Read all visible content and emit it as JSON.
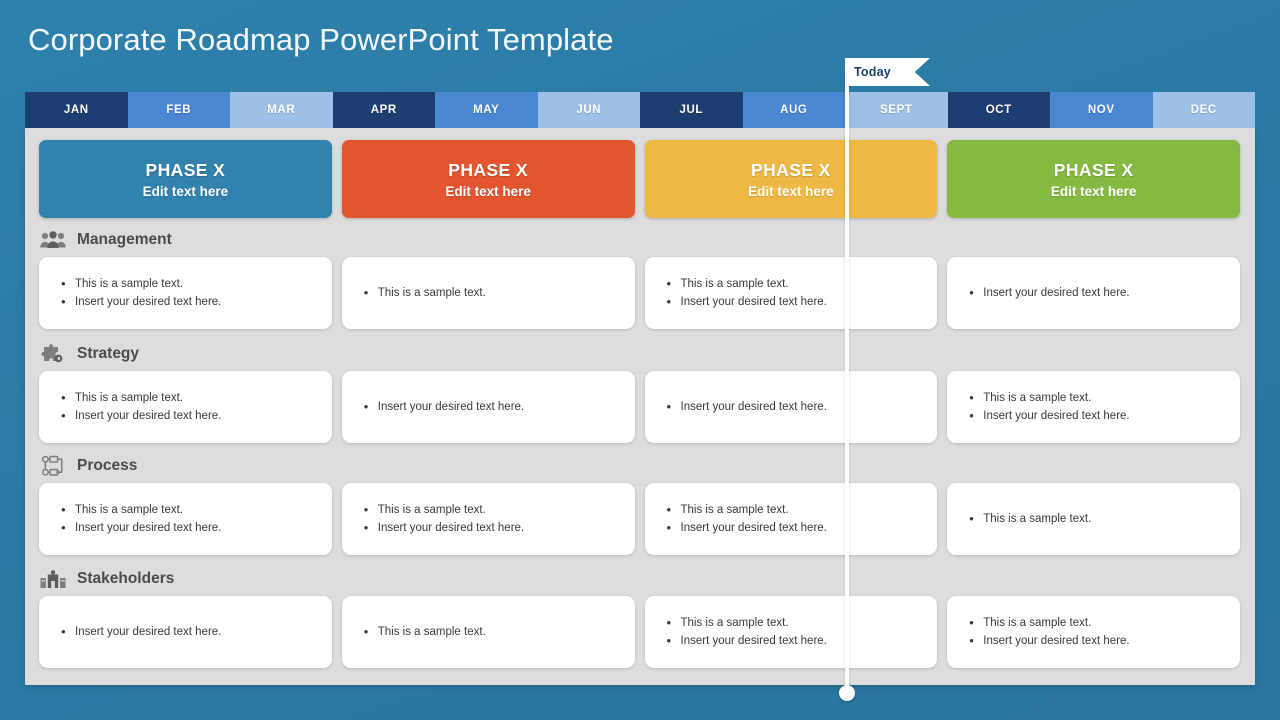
{
  "title": "Corporate Roadmap PowerPoint Template",
  "colors": {
    "background": "#2b7aa5",
    "panel": "#dddddd",
    "month_dark": "#1d3e70",
    "month_mid": "#4a86d2",
    "month_light": "#9cc0e6",
    "today_text": "#1d3e70",
    "card": "#ffffff",
    "label": "#4b4b4b"
  },
  "today": {
    "label": "Today"
  },
  "timeline": {
    "months": [
      {
        "label": "JAN",
        "tone": "dark"
      },
      {
        "label": "FEB",
        "tone": "mid"
      },
      {
        "label": "MAR",
        "tone": "light"
      },
      {
        "label": "APR",
        "tone": "dark"
      },
      {
        "label": "MAY",
        "tone": "mid"
      },
      {
        "label": "JUN",
        "tone": "light"
      },
      {
        "label": "JUL",
        "tone": "dark"
      },
      {
        "label": "AUG",
        "tone": "mid"
      },
      {
        "label": "SEPT",
        "tone": "light"
      },
      {
        "label": "OCT",
        "tone": "dark"
      },
      {
        "label": "NOV",
        "tone": "mid"
      },
      {
        "label": "DEC",
        "tone": "light"
      }
    ]
  },
  "phases": [
    {
      "title": "PHASE X",
      "subtitle": "Edit text here",
      "color": "#3282ae"
    },
    {
      "title": "PHASE X",
      "subtitle": "Edit text here",
      "color": "#e2552f"
    },
    {
      "title": "PHASE X",
      "subtitle": "Edit text here",
      "color": "#edb944"
    },
    {
      "title": "PHASE X",
      "subtitle": "Edit text here",
      "color": "#86b942"
    }
  ],
  "rows": [
    {
      "label": "Management",
      "icon": "people-group-icon",
      "cards": [
        {
          "bullets": [
            "This is a sample text.",
            "Insert your desired text here."
          ]
        },
        {
          "bullets": [
            "This is a sample text."
          ]
        },
        {
          "bullets": [
            "This is a sample text.",
            "Insert your desired text here."
          ]
        },
        {
          "bullets": [
            "Insert your desired text here."
          ]
        }
      ]
    },
    {
      "label": "Strategy",
      "icon": "puzzle-piece-icon",
      "cards": [
        {
          "bullets": [
            "This is a sample text.",
            "Insert your desired text here."
          ]
        },
        {
          "bullets": [
            "Insert your desired text here."
          ]
        },
        {
          "bullets": [
            "Insert your desired text here."
          ]
        },
        {
          "bullets": [
            "This is a sample text.",
            "Insert your desired text here."
          ]
        }
      ]
    },
    {
      "label": "Process",
      "icon": "workflow-icon",
      "cards": [
        {
          "bullets": [
            "This is a sample text.",
            "Insert your desired text here."
          ]
        },
        {
          "bullets": [
            "This is a sample text.",
            "Insert your desired text here."
          ]
        },
        {
          "bullets": [
            "This is a sample text.",
            "Insert your desired text here."
          ]
        },
        {
          "bullets": [
            "This is a sample text."
          ]
        }
      ]
    },
    {
      "label": "Stakeholders",
      "icon": "stakeholder-buildings-icon",
      "cards": [
        {
          "bullets": [
            "Insert your desired text here."
          ]
        },
        {
          "bullets": [
            "This is a sample text."
          ]
        },
        {
          "bullets": [
            "This is a sample text.",
            "Insert your desired text here."
          ]
        },
        {
          "bullets": [
            "This is a sample text.",
            "Insert your desired text here."
          ]
        }
      ]
    }
  ]
}
